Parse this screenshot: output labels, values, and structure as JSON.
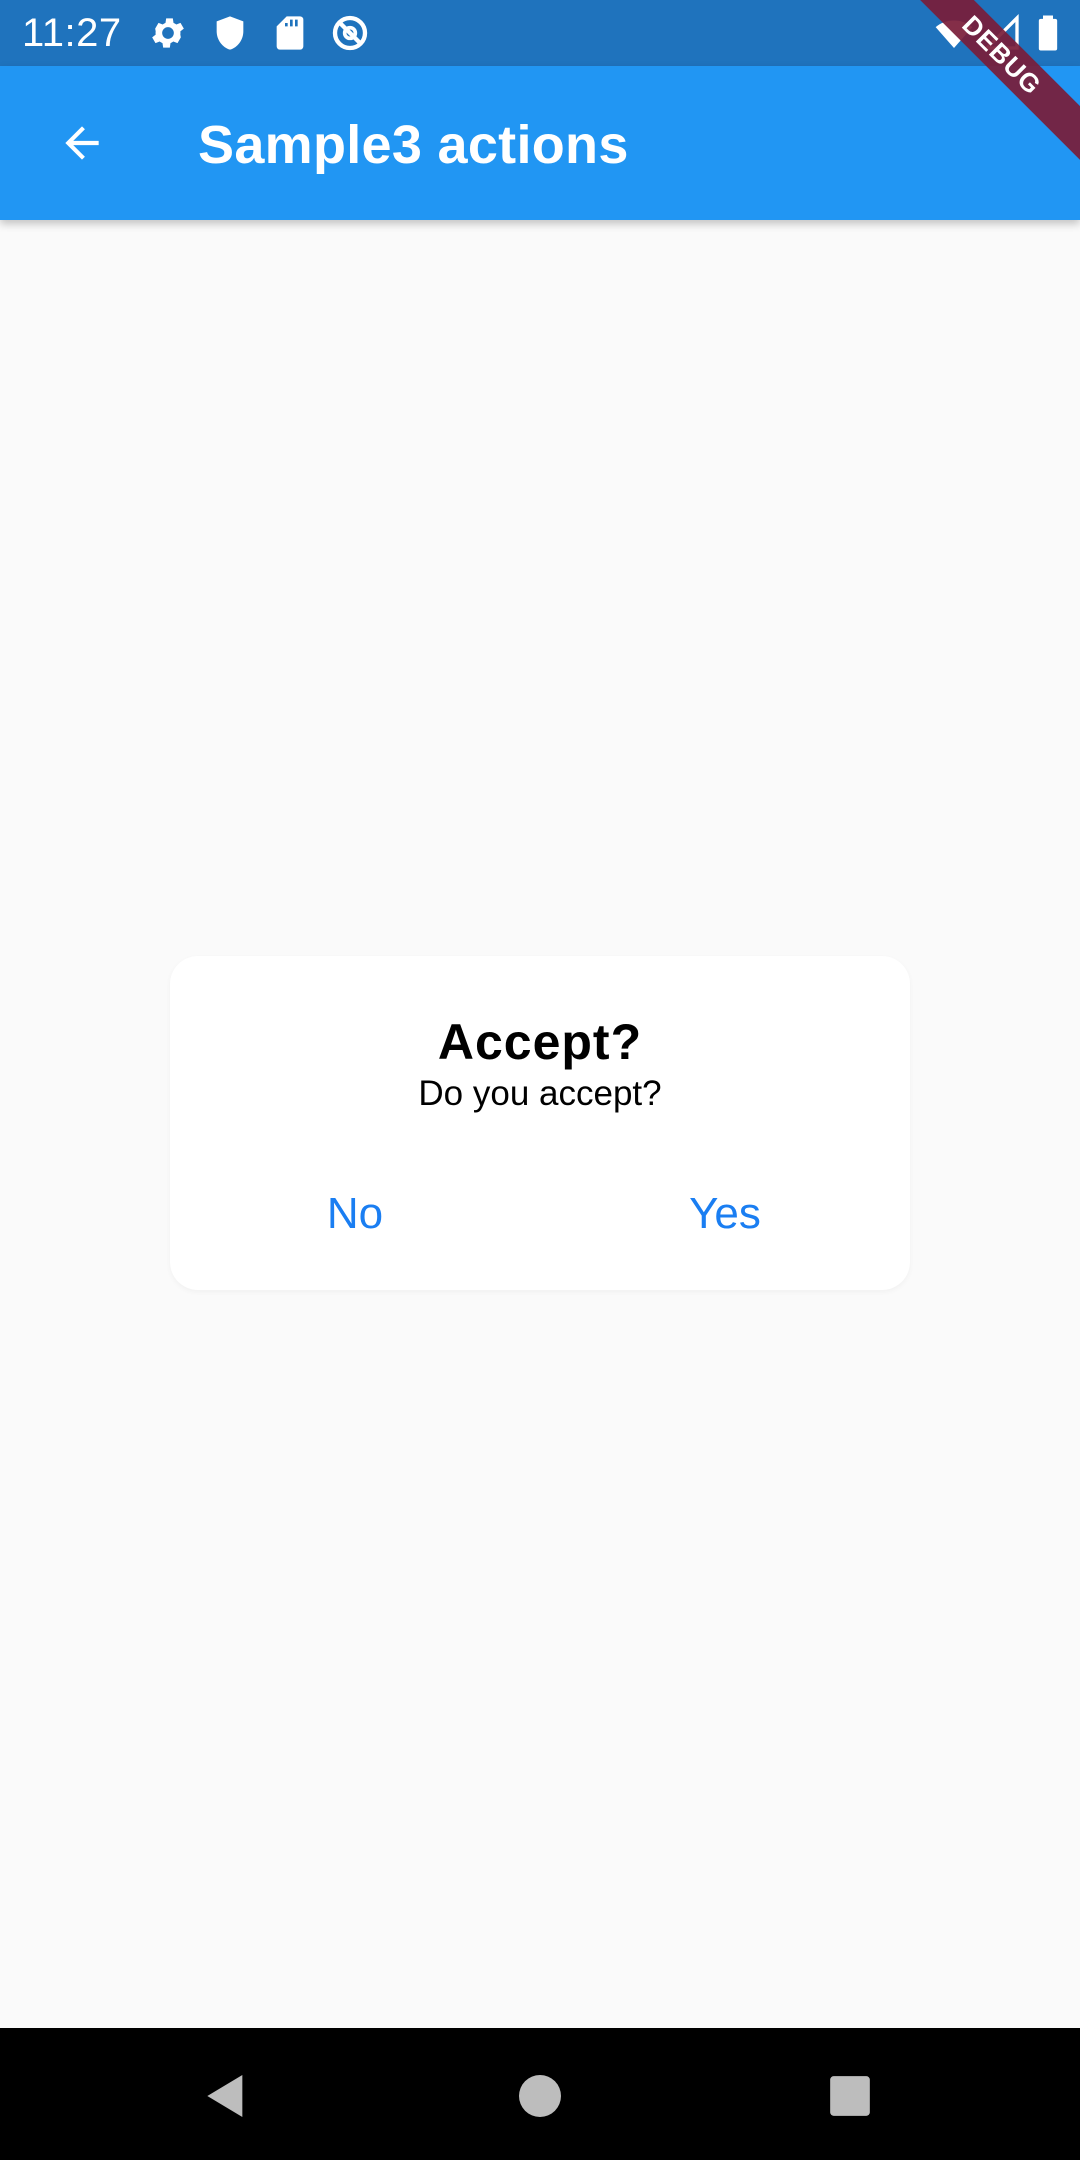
{
  "status_bar": {
    "time": "11:27",
    "icons_left": [
      "settings-icon",
      "shield-icon",
      "sd-card-icon",
      "do-not-disturb-icon"
    ],
    "icons_right": [
      "wifi-icon",
      "cellular-signal-icon",
      "battery-icon"
    ],
    "color": "#1f73bd"
  },
  "app_bar": {
    "title": "Sample3 actions",
    "back_icon": "arrow-back-icon",
    "color": "#2196f3"
  },
  "debug_banner": {
    "label": "DEBUG",
    "color": "#7a1c38"
  },
  "dialog": {
    "title": "Accept?",
    "message": "Do you accept?",
    "actions": [
      {
        "label": "No"
      },
      {
        "label": "Yes"
      }
    ],
    "action_color": "#1a7ef2"
  },
  "nav_bar": {
    "buttons": [
      "back-triangle-icon",
      "home-circle-icon",
      "recents-square-icon"
    ]
  }
}
